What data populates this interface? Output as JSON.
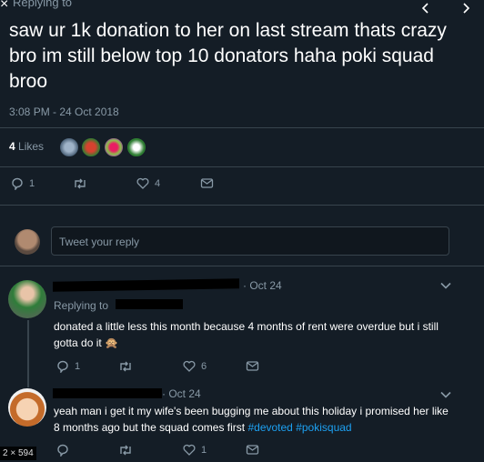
{
  "header": {
    "close_icon": "×",
    "replying_to": "Replying to",
    "nav_prev_icon": "chevron-left-icon",
    "nav_next_icon": "chevron-right-icon"
  },
  "main_tweet": {
    "text": "saw ur 1k donation to her on last stream thats crazy bro im still below top 10 donators haha poki squad broo",
    "timestamp": "3:08 PM - 24 Oct 2018",
    "likes_count": "4",
    "likes_label": "Likes",
    "actions": {
      "reply": "1",
      "retweet": "",
      "like": "4",
      "message": ""
    }
  },
  "reply_box": {
    "placeholder": "Tweet your reply"
  },
  "replies": [
    {
      "date": "· Oct 24",
      "replying_to": "Replying to",
      "text": "donated a little less this month because 4 months of rent were overdue but i still gotta do it",
      "emoji": "🙊",
      "actions": {
        "reply": "1",
        "retweet": "",
        "like": "6",
        "message": ""
      }
    },
    {
      "date": "· Oct 24",
      "text": "yeah man i get it my wife's been bugging me about this holiday i promised her like 8 months ago but the squad comes first",
      "hashtags": [
        "#devoted",
        "#pokisquad"
      ],
      "actions": {
        "reply": "",
        "retweet": "",
        "like": "1",
        "message": ""
      }
    }
  ],
  "overlay": {
    "dimensions": "2 × 594"
  },
  "colors": {
    "background": "#141d26",
    "muted": "#8899a6",
    "link": "#1da1f2",
    "divider": "#38444d"
  }
}
